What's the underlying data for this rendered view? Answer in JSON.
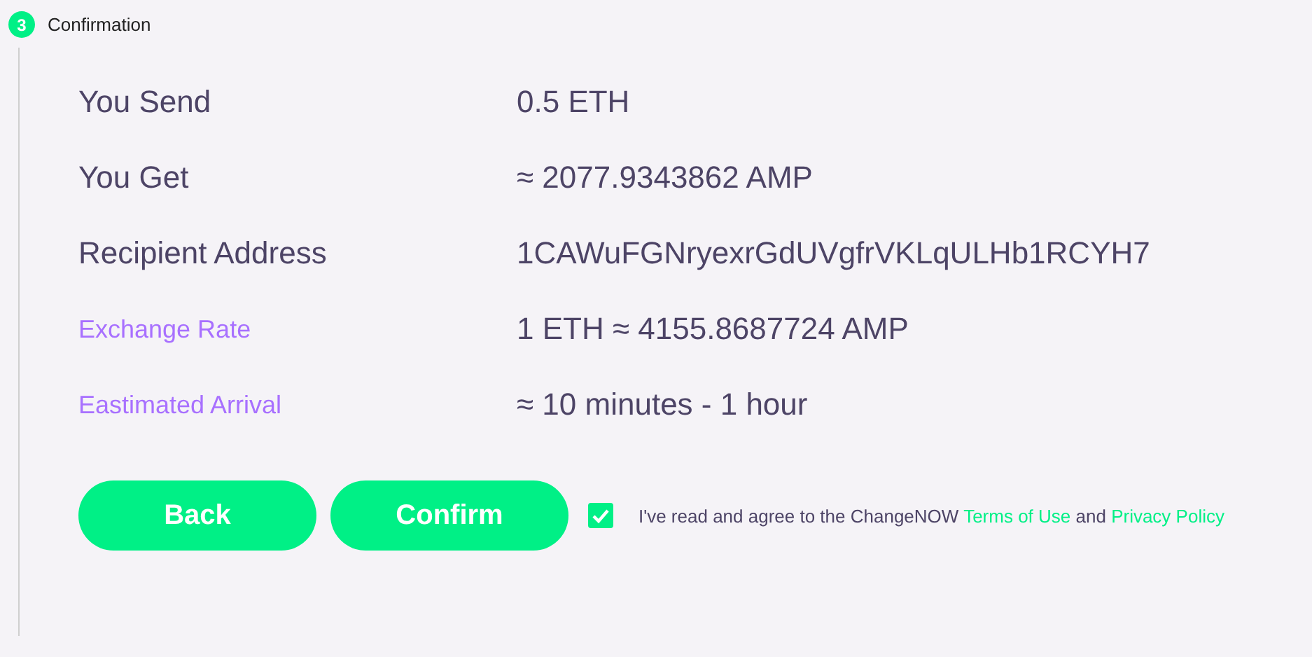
{
  "step": {
    "number": "3",
    "title": "Confirmation"
  },
  "details": [
    {
      "label": "You Send",
      "value": "0.5 ETH",
      "kind": "main"
    },
    {
      "label": "You Get",
      "value": "≈ 2077.9343862 AMP",
      "kind": "main"
    },
    {
      "label": "Recipient Address",
      "value": "1CAWuFGNryexrGdUVgfrVKLqULHb1RCYH7",
      "kind": "main"
    },
    {
      "label": "Exchange Rate",
      "value": "1 ETH  ≈ 4155.8687724 AMP",
      "kind": "info"
    },
    {
      "label": "Eastimated Arrival",
      "value": "≈ 10 minutes - 1 hour",
      "kind": "info"
    }
  ],
  "buttons": [
    "Back",
    "Confirm"
  ],
  "agreement": {
    "checked": true,
    "text_before": "I've read and agree to the ChangeNOW",
    "terms_link": "Terms of Use",
    "text_middle": "and",
    "privacy_link": "Privacy Policy"
  }
}
